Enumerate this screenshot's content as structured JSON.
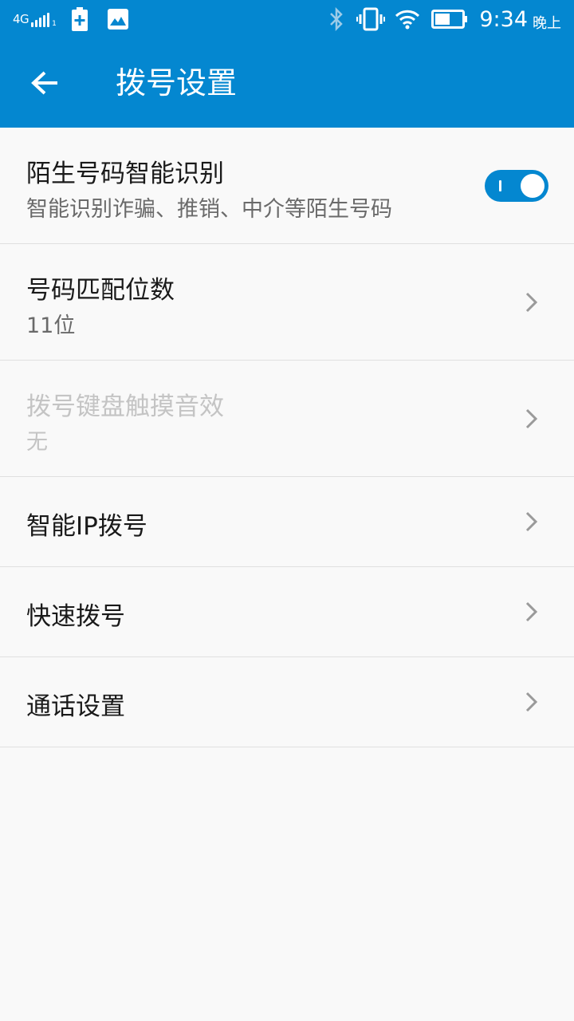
{
  "status_bar": {
    "network": "4G",
    "signal_sub": "1",
    "time": "9:34",
    "ampm": "晚上",
    "battery_level": 0.55,
    "icons": [
      "signal-icon",
      "battery-charging-icon",
      "image-icon",
      "bluetooth-icon",
      "vibrate-icon",
      "wifi-icon",
      "battery-icon"
    ]
  },
  "header": {
    "title": "拨号设置",
    "back_icon": "arrow-left-icon",
    "background_color": "#0487d0"
  },
  "settings": {
    "stranger_id": {
      "title": "陌生号码智能识别",
      "subtitle": "智能识别诈骗、推销、中介等陌生号码",
      "enabled": true
    },
    "match_digits": {
      "title": "号码匹配位数",
      "value": "11位"
    },
    "keypad_sound": {
      "title": "拨号键盘触摸音效",
      "value": "无",
      "disabled": true
    },
    "smart_ip": {
      "title": "智能IP拨号"
    },
    "speed_dial": {
      "title": "快速拨号"
    },
    "call_settings": {
      "title": "通话设置"
    }
  },
  "colors": {
    "accent": "#0487d0",
    "text_primary": "#1a1a1a",
    "text_secondary": "#6a6a6a",
    "text_disabled": "#c4c4c4",
    "divider": "#e0e0e0",
    "background": "#f9f9f9"
  }
}
